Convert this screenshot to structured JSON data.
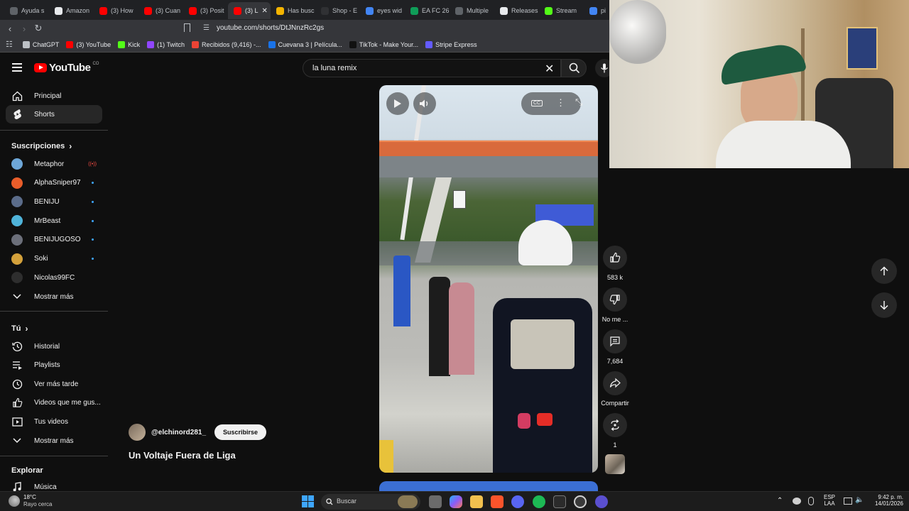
{
  "browser": {
    "tabs": [
      {
        "label": "Ayuda s",
        "color": "#5f6368"
      },
      {
        "label": "Amazon",
        "color": "#e8eaed"
      },
      {
        "label": "(3) How",
        "color": "#ff0000"
      },
      {
        "label": "(3) Cuan",
        "color": "#ff0000"
      },
      {
        "label": "(3) Posit",
        "color": "#ff0000"
      },
      {
        "label": "(3) L",
        "color": "#ff0000",
        "active": true
      },
      {
        "label": "Has busc",
        "color": "#f4b400"
      },
      {
        "label": "Shop - E",
        "color": "#303134"
      },
      {
        "label": "eyes wid",
        "color": "#4285f4"
      },
      {
        "label": "EA FC 26",
        "color": "#0f9d58"
      },
      {
        "label": "Multiple",
        "color": "#5f6368"
      },
      {
        "label": "Releases",
        "color": "#e8eaed"
      },
      {
        "label": "Stream",
        "color": "#53fc18"
      },
      {
        "label": "pi",
        "color": "#4285f4"
      }
    ],
    "url": "youtube.com/shorts/DtJNnzRc2gs",
    "bookmarks": [
      {
        "label": "ChatGPT",
        "color": "#bdc1c6"
      },
      {
        "label": "(3) YouTube",
        "color": "#ff0000"
      },
      {
        "label": "Kick",
        "color": "#53fc18"
      },
      {
        "label": "(1) Twitch",
        "color": "#9146ff"
      },
      {
        "label": "Recibidos (9,416) -...",
        "color": "#ea4335"
      },
      {
        "label": "Cuevana 3 | Película...",
        "color": "#1a73e8"
      },
      {
        "label": "TikTok - Make Your...",
        "color": "#111111"
      },
      {
        "label": "Stripe Express",
        "color": "#635bff"
      }
    ]
  },
  "youtube": {
    "logo_text": "YouTube",
    "logo_region": "CO",
    "search_query": "la luna remix",
    "sidebar": {
      "main": [
        {
          "label": "Principal",
          "icon": "home-icon"
        },
        {
          "label": "Shorts",
          "icon": "shorts-icon",
          "active": true
        }
      ],
      "subscriptions_title": "Suscripciones",
      "subscriptions": [
        {
          "label": "Metaphor",
          "color": "#6ea7d8",
          "badge": "live"
        },
        {
          "label": "AlphaSniper97",
          "color": "#e85d2a",
          "badge": "dot"
        },
        {
          "label": "BENIJU",
          "color": "#5b6c8a",
          "badge": "dot"
        },
        {
          "label": "MrBeast",
          "color": "#4fb3d9",
          "badge": "dot"
        },
        {
          "label": "BENIJUGOSO",
          "color": "#6c6f7a",
          "badge": "dot"
        },
        {
          "label": "Soki",
          "color": "#d4a13b",
          "badge": "dot"
        },
        {
          "label": "Nicolas99FC",
          "color": "#2e2e2e",
          "badge": ""
        }
      ],
      "show_more": "Mostrar más",
      "you_title": "Tú",
      "you_items": [
        {
          "label": "Historial",
          "icon": "history-icon"
        },
        {
          "label": "Playlists",
          "icon": "playlists-icon"
        },
        {
          "label": "Ver más tarde",
          "icon": "watch-later-icon"
        },
        {
          "label": "Videos que me gus...",
          "icon": "liked-videos-icon"
        },
        {
          "label": "Tus videos",
          "icon": "your-videos-icon"
        }
      ],
      "show_more_2": "Mostrar más",
      "explore_title": "Explorar",
      "explore_items": [
        {
          "label": "Música",
          "icon": "music-icon"
        }
      ]
    },
    "short": {
      "channel": "@elchinord281_",
      "subscribe": "Suscribirse",
      "title": "Un Voltaje Fuera de Liga",
      "likes": "583 k",
      "dislike_label": "No me ...",
      "comments": "7,684",
      "share_label": "Compartir",
      "remix_count": "1"
    }
  },
  "taskbar": {
    "weather_temp": "18°C",
    "weather_desc": "Rayo cerca",
    "search_placeholder": "Buscar",
    "lang_line1": "ESP",
    "lang_line2": "LAA",
    "time": "9:42 p. m.",
    "date": "14/01/2026"
  }
}
